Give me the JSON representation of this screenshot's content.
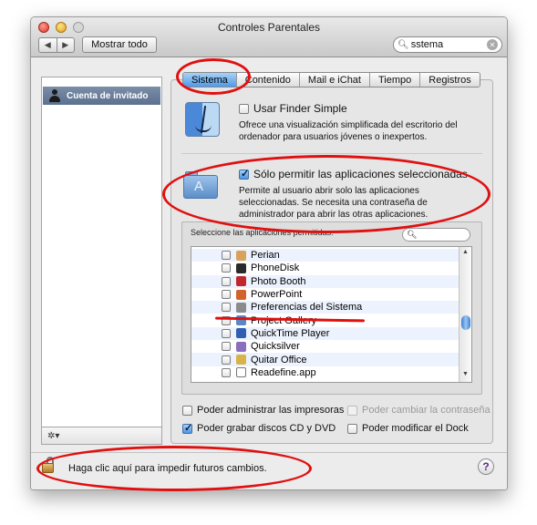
{
  "window": {
    "title": "Controles Parentales"
  },
  "toolbar": {
    "back_glyph": "◀",
    "forward_glyph": "▶",
    "show_all_label": "Mostrar todo",
    "search_value": "sstema"
  },
  "sidebar": {
    "items": [
      {
        "label": "Cuenta de invitado",
        "icon": "user-icon"
      }
    ],
    "actions_glyph": "✲▾"
  },
  "tabs": [
    {
      "label": "Sistema",
      "active": true
    },
    {
      "label": "Contenido",
      "active": false
    },
    {
      "label": "Mail e iChat",
      "active": false
    },
    {
      "label": "Tiempo",
      "active": false
    },
    {
      "label": "Registros",
      "active": false
    }
  ],
  "finder": {
    "option_label": "Usar Finder Simple",
    "checked": false,
    "description": "Ofrece una visualización simplificada del escritorio del ordenador para usuarios jóvenes o inexpertos."
  },
  "apps_limit": {
    "option_label": "Sólo permitir las aplicaciones seleccionadas",
    "checked": true,
    "description": "Permite al usuario abrir solo las aplicaciones seleccionadas. Se necesita una contraseña de administrador para abrir las otras aplicaciones."
  },
  "applist": {
    "label": "Seleccione las aplicaciones permitidas:",
    "search_placeholder": "",
    "items": [
      {
        "name": "Perian",
        "checked": false,
        "icon_color": "#d9a25a"
      },
      {
        "name": "PhoneDisk",
        "checked": false,
        "icon_color": "#2a2a2a"
      },
      {
        "name": "Photo Booth",
        "checked": false,
        "icon_color": "#c0272d"
      },
      {
        "name": "PowerPoint",
        "checked": false,
        "icon_color": "#d2632a"
      },
      {
        "name": "Preferencias del Sistema",
        "checked": false,
        "icon_color": "#8b8b8b"
      },
      {
        "name": "Project Gallery",
        "checked": false,
        "icon_color": "#5b87c4"
      },
      {
        "name": "QuickTime Player",
        "checked": false,
        "icon_color": "#2e5fb3"
      },
      {
        "name": "Quicksilver",
        "checked": false,
        "icon_color": "#8a6fbf"
      },
      {
        "name": "Quitar Office",
        "checked": false,
        "icon_color": "#d8b24a"
      },
      {
        "name": "Readefine.app",
        "checked": false,
        "icon_color": "#ffffff"
      }
    ]
  },
  "options": [
    {
      "label": "Poder administrar las impresoras",
      "checked": false,
      "enabled": true
    },
    {
      "label": "Poder cambiar la contraseña",
      "checked": false,
      "enabled": false
    },
    {
      "label": "Poder grabar discos CD y DVD",
      "checked": true,
      "enabled": true
    },
    {
      "label": "Poder modificar el Dock",
      "checked": false,
      "enabled": true
    }
  ],
  "lock": {
    "text": "Haga clic aquí para impedir futuros cambios."
  },
  "help": {
    "glyph": "?"
  },
  "colors": {
    "annotation": "#e01010",
    "selection": "#4f9ae8"
  }
}
